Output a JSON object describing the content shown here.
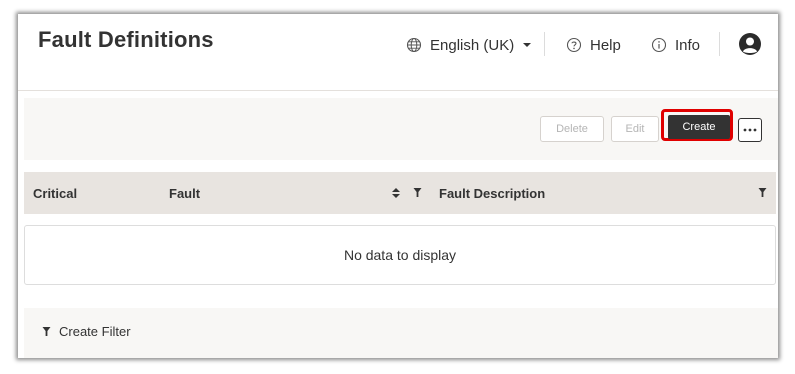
{
  "page": {
    "title": "Fault Definitions"
  },
  "header": {
    "language_label": "English (UK)",
    "help_label": "Help",
    "info_label": "Info"
  },
  "toolbar": {
    "delete_label": "Delete",
    "edit_label": "Edit",
    "create_label": "Create"
  },
  "table": {
    "columns": [
      "Critical",
      "Fault",
      "Fault Description"
    ],
    "empty_message": "No data to display"
  },
  "footer": {
    "create_filter_label": "Create Filter"
  },
  "colors": {
    "primary_button": "#333333",
    "highlight_ring": "#e00000",
    "header_row_bg": "#e8e4e0"
  }
}
